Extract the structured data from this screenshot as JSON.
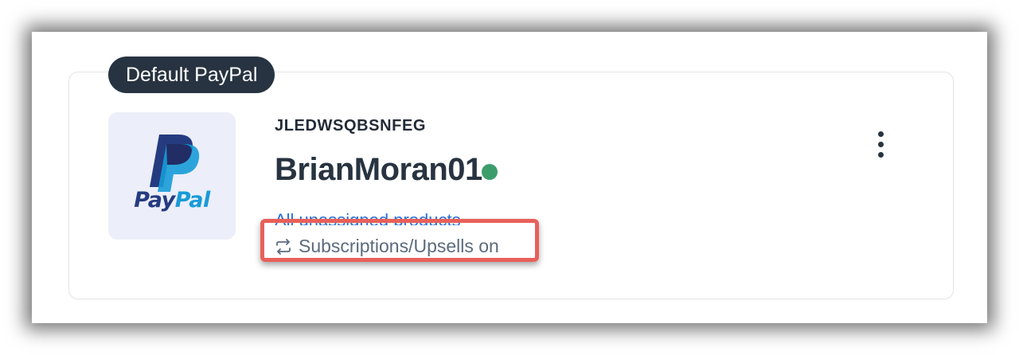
{
  "badge": {
    "label": "Default PayPal"
  },
  "gateway": {
    "logo_icon": "paypal-logo-icon",
    "logo_word_1": "Pay",
    "logo_word_2": "Pal",
    "account_id": "JLEDWSQBSNFEG",
    "account_name": "BrianMoran01",
    "status": "active",
    "products_link": "All unassigned products",
    "subscriptions_icon": "repeat-arrows-icon",
    "subscriptions_text": "Subscriptions/Upsells on",
    "menu_icon": "kebab-menu-icon"
  },
  "colors": {
    "badge_bg": "#273340",
    "status_green": "#3c9d6b",
    "link_blue": "#2e73d9",
    "highlight_red": "#e8605a",
    "paypal_dark_blue": "#253b80",
    "paypal_light_blue": "#179bd7"
  }
}
